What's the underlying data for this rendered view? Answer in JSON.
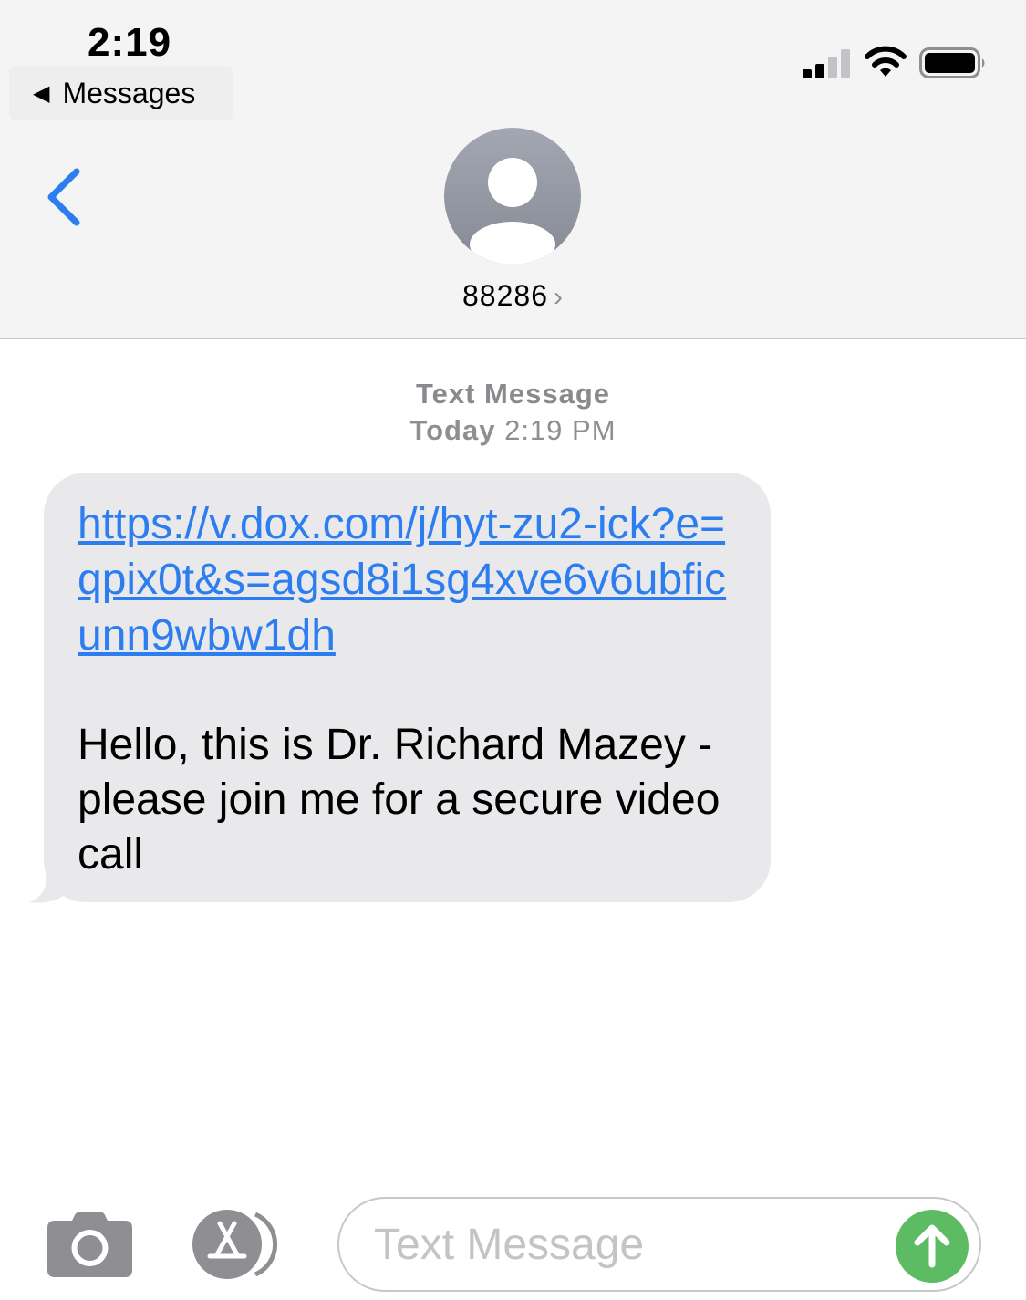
{
  "status_bar": {
    "time": "2:19",
    "back_app_label": "Messages",
    "back_app_glyph": "◀"
  },
  "header": {
    "contact_name": "88286",
    "contact_chevron": "›"
  },
  "thread": {
    "message_kind": "Text Message",
    "day": "Today",
    "time": "2:19 PM",
    "message": {
      "link": "https://v.dox.com/j/hyt-zu2-ick?e=qpix0t&s=agsd8i1sg4xve6v6ubficunn9wbw1dh",
      "body": "Hello, this is Dr. Richard Mazey - please join me for a secure video call"
    }
  },
  "composer": {
    "placeholder": "Text Message"
  },
  "colors": {
    "accent": "#2c7df0",
    "send_button": "#5dbb63",
    "bubble": "#e9e9eb"
  }
}
